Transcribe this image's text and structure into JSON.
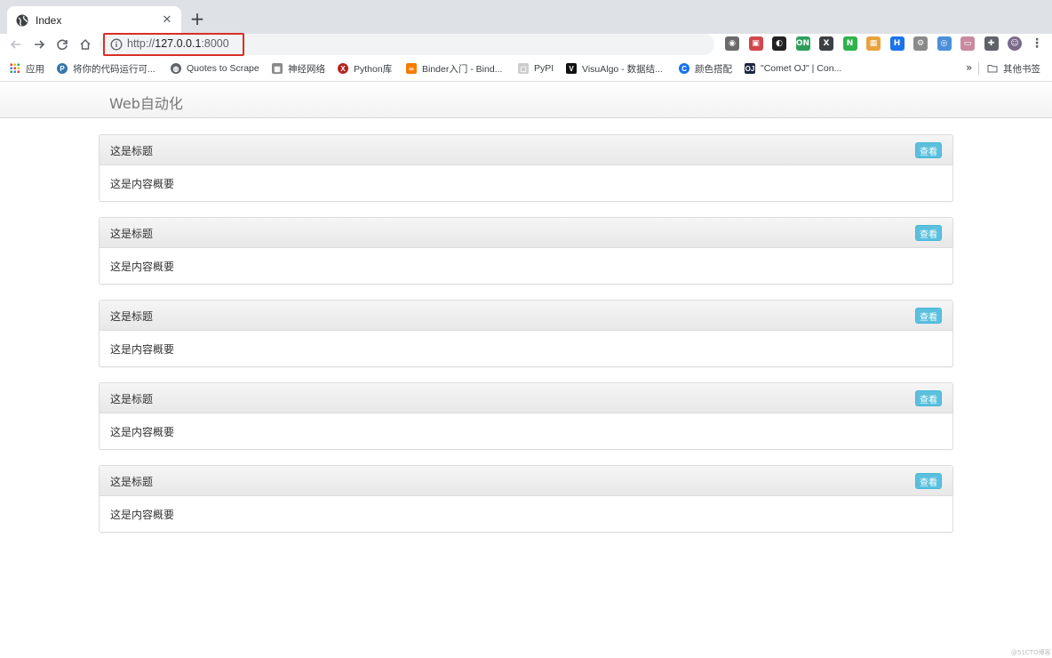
{
  "browser": {
    "tab": {
      "title": "Index",
      "close": "✕"
    },
    "new_tab": "+",
    "address": {
      "scheme": "http://",
      "host": "127.0.0.1",
      "port": ":8000"
    },
    "extensions": [
      {
        "name": "camera-icon",
        "color": "#6b6b6b",
        "glyph": "◉"
      },
      {
        "name": "presentation-icon",
        "color": "#d0474c",
        "glyph": "▣"
      },
      {
        "name": "ghost-icon",
        "color": "#222222",
        "glyph": "◐"
      },
      {
        "name": "on-toggle-icon",
        "color": "#2e9e5b",
        "glyph": "ON"
      },
      {
        "name": "x-icon",
        "color": "#3c4043",
        "glyph": "X"
      },
      {
        "name": "n-green-icon",
        "color": "#2fb24c",
        "glyph": "N"
      },
      {
        "name": "color-grid-icon",
        "color": "#e9a23b",
        "glyph": "▦"
      },
      {
        "name": "blue-square-icon",
        "color": "#1a73e8",
        "glyph": "H"
      },
      {
        "name": "gear-circle-icon",
        "color": "#8a8a8a",
        "glyph": "⚙"
      },
      {
        "name": "eye-icon",
        "color": "#4a90d9",
        "glyph": "◎"
      },
      {
        "name": "monitor-icon",
        "color": "#c98aa0",
        "glyph": "▭"
      },
      {
        "name": "puzzle-icon",
        "color": "#5f6368",
        "glyph": "✚"
      },
      {
        "name": "profile-avatar",
        "color": "#7a6a8a",
        "glyph": "☺"
      }
    ],
    "bookmarks": [
      {
        "label": "应用",
        "icon": "apps-grid-icon",
        "color": "#4285f4",
        "glyph": ""
      },
      {
        "label": "将你的代码运行可...",
        "icon": "python-icon",
        "color": "#3776ab",
        "glyph": "P"
      },
      {
        "label": "Quotes to Scrape",
        "icon": "globe-icon",
        "color": "#5f6368",
        "glyph": "◍"
      },
      {
        "label": "神经网络",
        "icon": "network-icon",
        "color": "#888888",
        "glyph": "▦"
      },
      {
        "label": "Python库",
        "icon": "x-circle-icon",
        "color": "#b3261e",
        "glyph": "X"
      },
      {
        "label": "Binder入门 - Bind...",
        "icon": "binder-icon",
        "color": "#f57c00",
        "glyph": "∞"
      },
      {
        "label": "PyPI",
        "icon": "pypi-icon",
        "color": "#cccccc",
        "glyph": "▢"
      },
      {
        "label": "VisuAlgo - 数据结...",
        "icon": "visualgo-icon",
        "color": "#111111",
        "glyph": "V"
      },
      {
        "label": "颜色搭配",
        "icon": "c-blue-icon",
        "color": "#1a73e8",
        "glyph": "C"
      },
      {
        "label": "\"Comet OJ\" | Con...",
        "icon": "cometoj-icon",
        "color": "#1c2541",
        "glyph": "OJ"
      }
    ],
    "more": "»",
    "other_bookmarks": "其他书签"
  },
  "page": {
    "brand": "Web自动化",
    "panels": [
      {
        "title": "这是标题",
        "content": "这是内容概要",
        "button": "查看"
      },
      {
        "title": "这是标题",
        "content": "这是内容概要",
        "button": "查看"
      },
      {
        "title": "这是标题",
        "content": "这是内容概要",
        "button": "查看"
      },
      {
        "title": "这是标题",
        "content": "这是内容概要",
        "button": "查看"
      },
      {
        "title": "这是标题",
        "content": "这是内容概要",
        "button": "查看"
      }
    ]
  },
  "watermark": "@51CTO博客",
  "colors": {
    "info_button": "#5bc0de",
    "highlight_box": "#d93025",
    "tabstrip": "#dee1e6"
  }
}
